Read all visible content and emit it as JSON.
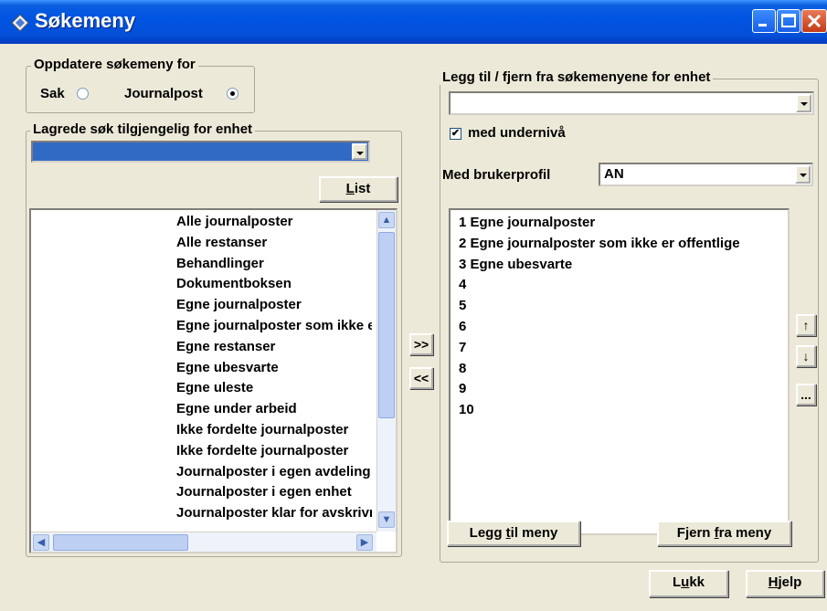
{
  "window": {
    "title": "Søkemeny"
  },
  "update_group": {
    "legend": "Oppdatere søkemeny for",
    "options": [
      {
        "label": "Sak",
        "selected": false
      },
      {
        "label": "Journalpost",
        "selected": true
      }
    ]
  },
  "saved_group": {
    "legend": "Lagrede søk tilgjengelig for enhet",
    "combo_value": "",
    "list_button": {
      "mnemonic": "L",
      "rest": "ist"
    },
    "items": [
      "Alle journalposter",
      "Alle restanser",
      "Behandlinger",
      "Dokumentboksen",
      "Egne journalposter",
      "Egne journalposter som ikke er offentlige",
      "Egne restanser",
      "Egne ubesvarte",
      "Egne uleste",
      "Egne under arbeid",
      "Ikke fordelte journalposter",
      "Ikke fordelte journalposter",
      "Journalposter i egen avdeling",
      "Journalposter i egen enhet",
      "Journalposter klar for avskrivning"
    ]
  },
  "transfer": {
    "add": ">>",
    "remove": "<<"
  },
  "right_group": {
    "legend": "Legg til / fjern fra søkemenyene for enhet",
    "combo_value": "",
    "checkbox": {
      "label": "med undernivå",
      "checked": true,
      "mark": "✔"
    },
    "profile_label": "Med brukerprofil",
    "profile_value": "AN",
    "menu_items": [
      "1 Egne journalposter",
      "2 Egne journalposter som ikke er offentlige",
      "3 Egne ubesvarte",
      "4",
      "5",
      "6",
      "7",
      "8",
      "9",
      "10"
    ],
    "move_up": "↑",
    "move_down": "↓",
    "more": "...",
    "add_button": {
      "pre": "Legg ",
      "mnemonic": "t",
      "post": "il meny"
    },
    "remove_button": {
      "pre": "Fjern ",
      "mnemonic": "f",
      "post": "ra meny"
    }
  },
  "footer": {
    "close_button": {
      "pre": "L",
      "mnemonic": "u",
      "post": "kk"
    },
    "help_button": {
      "pre": "",
      "mnemonic": "H",
      "post": "jelp"
    }
  },
  "colors": {
    "titlebar": "#0054e3",
    "selection": "#316ac5",
    "face": "#ece9d8"
  }
}
